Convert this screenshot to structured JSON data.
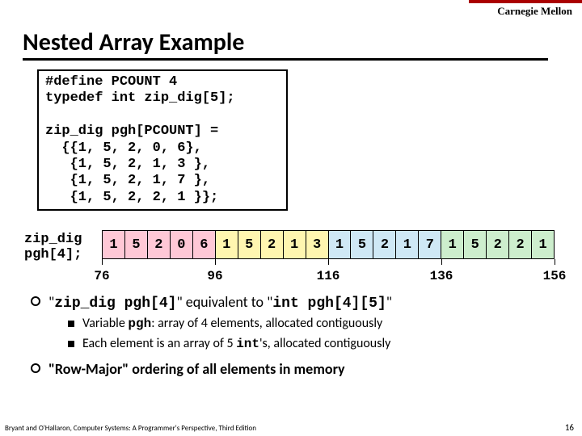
{
  "brand": "Carnegie Mellon",
  "title": "Nested Array Example",
  "code": "#define PCOUNT 4\ntypedef int zip_dig[5];\n\nzip_dig pgh[PCOUNT] =\n  {{1, 5, 2, 0, 6},\n   {1, 5, 2, 1, 3 },\n   {1, 5, 2, 1, 7 },\n   {1, 5, 2, 2, 1 }};",
  "decl_line1": "zip_dig",
  "decl_line2": "pgh[4];",
  "cells": [
    "1",
    "5",
    "2",
    "0",
    "6",
    "1",
    "5",
    "2",
    "1",
    "3",
    "1",
    "5",
    "2",
    "1",
    "7",
    "1",
    "5",
    "2",
    "2",
    "1"
  ],
  "addrs": [
    "76",
    "96",
    "116",
    "136",
    "156"
  ],
  "bullet1_pre": "\"",
  "bullet1_a": "zip_dig pgh[4]",
  "bullet1_mid": "\" equivalent to \"",
  "bullet1_b": "int pgh[4][5]",
  "bullet1_post": "\"",
  "sub1_pre": "Variable ",
  "sub1_var": "pgh",
  "sub1_post": ": array of 4 elements, allocated contiguously",
  "sub2_pre": "Each element is an array of 5 ",
  "sub2_var": "int",
  "sub2_post": "'s, allocated contiguously",
  "bullet2": "\"Row-Major\" ordering of all elements in memory",
  "footer": "Bryant and O'Hallaron, Computer Systems: A Programmer's Perspective, Third Edition",
  "page": "16",
  "chart_data": {
    "type": "table",
    "title": "pgh memory layout",
    "rows": [
      {
        "addr_start": 76,
        "values": [
          1,
          5,
          2,
          0,
          6
        ]
      },
      {
        "addr_start": 96,
        "values": [
          1,
          5,
          2,
          1,
          3
        ]
      },
      {
        "addr_start": 116,
        "values": [
          1,
          5,
          2,
          1,
          7
        ]
      },
      {
        "addr_start": 136,
        "values": [
          1,
          5,
          2,
          2,
          1
        ]
      }
    ],
    "addr_end": 156
  }
}
